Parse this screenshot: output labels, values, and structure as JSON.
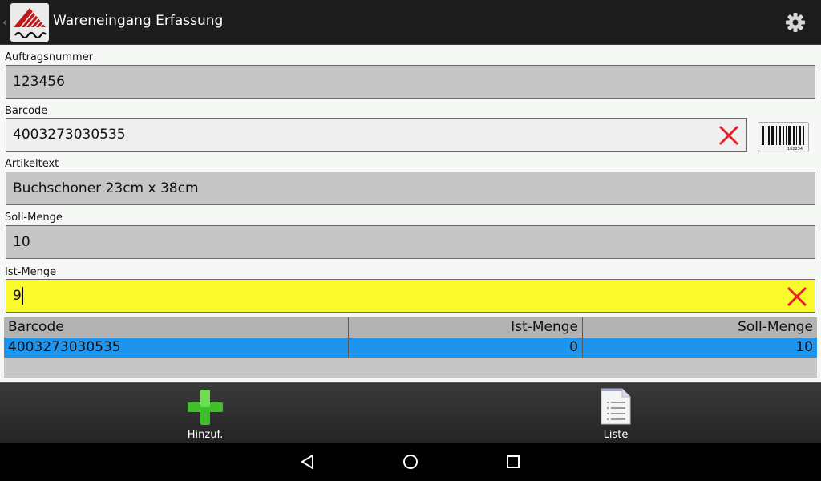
{
  "header": {
    "title": "Wareneingang Erfassung",
    "up_glyph": "‹",
    "logo_icon": "company-logo",
    "settings_icon": "gear-icon"
  },
  "form": {
    "auftragsnummer": {
      "label": "Auftragsnummer",
      "value": "123456"
    },
    "barcode": {
      "label": "Barcode",
      "value": "4003273030535",
      "barcode_icon_text": "102234"
    },
    "artikeltext": {
      "label": "Artikeltext",
      "value": "Buchschoner 23cm x 38cm"
    },
    "soll_menge": {
      "label": "Soll-Menge",
      "value": "10"
    },
    "ist_menge": {
      "label": "Ist-Menge",
      "value": "9"
    }
  },
  "table": {
    "columns": [
      "Barcode",
      "Ist-Menge",
      "Soll-Menge"
    ],
    "rows": [
      [
        "4003273030535",
        "0",
        "10"
      ]
    ]
  },
  "bottom_bar": {
    "add_label": "Hinzuf.",
    "list_label": "Liste"
  },
  "colors": {
    "accent_yellow": "#fafa2c",
    "selected_row": "#1d95ee",
    "clear_red": "#e8202a",
    "add_green": "#3fbf2a"
  }
}
